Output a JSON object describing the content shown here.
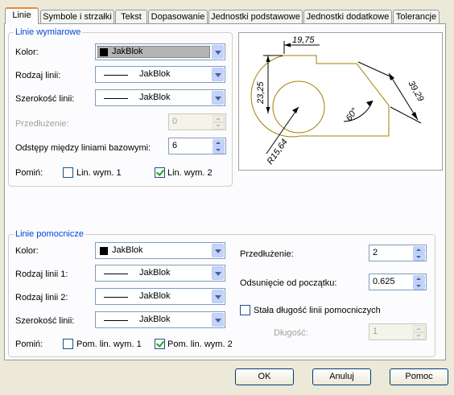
{
  "tabs": [
    "Linie",
    "Symbole i strzałki",
    "Tekst",
    "Dopasowanie",
    "Jednostki podstawowe",
    "Jednostki dodatkowe",
    "Tolerancje"
  ],
  "dim_lines": {
    "legend": "Linie wymiarowe",
    "color_label": "Kolor:",
    "color_value": "JakBlok",
    "linetype_label": "Rodzaj linii:",
    "linetype_value": "JakBlok",
    "lineweight_label": "Szerokość linii:",
    "lineweight_value": "JakBlok",
    "extension_label": "Przedłużenie:",
    "extension_value": "0",
    "baseline_spacing_label": "Odstępy między liniami bazowymi:",
    "baseline_spacing_value": "6",
    "suppress_label": "Pomiń:",
    "suppress_1_label": "Lin. wym. 1",
    "suppress_1_checked": false,
    "suppress_2_label": "Lin. wym. 2",
    "suppress_2_checked": true
  },
  "preview": {
    "dim_top": "19,75",
    "dim_left": "23,25",
    "dim_right": "39,29",
    "dim_angle": "60°",
    "dim_radius": "R15,64",
    "outline_color": "#a08000"
  },
  "ext_lines": {
    "legend": "Linie pomocnicze",
    "color_label": "Kolor:",
    "color_value": "JakBlok",
    "linetype1_label": "Rodzaj linii 1:",
    "linetype1_value": "JakBlok",
    "linetype2_label": "Rodzaj linii 2:",
    "linetype2_value": "JakBlok",
    "lineweight_label": "Szerokość linii:",
    "lineweight_value": "JakBlok",
    "suppress_label": "Pomiń:",
    "suppress_1_label": "Pom. lin. wym. 1",
    "suppress_1_checked": false,
    "suppress_2_label": "Pom. lin. wym. 2",
    "suppress_2_checked": true,
    "extension_label": "Przedłużenie:",
    "extension_value": "2",
    "offset_label": "Odsunięcie od początku:",
    "offset_value": "0.625",
    "fixed_length_label": "Stała długość linii pomocniczych",
    "fixed_length_checked": false,
    "length_label": "Długość:",
    "length_value": "1"
  },
  "buttons": {
    "ok": "OK",
    "cancel": "Anuluj",
    "help": "Pomoc"
  },
  "colors": {
    "accent_tab": "#e68b2c",
    "group_legend": "#0046d5",
    "dialog_bg": "#ece9d8"
  }
}
